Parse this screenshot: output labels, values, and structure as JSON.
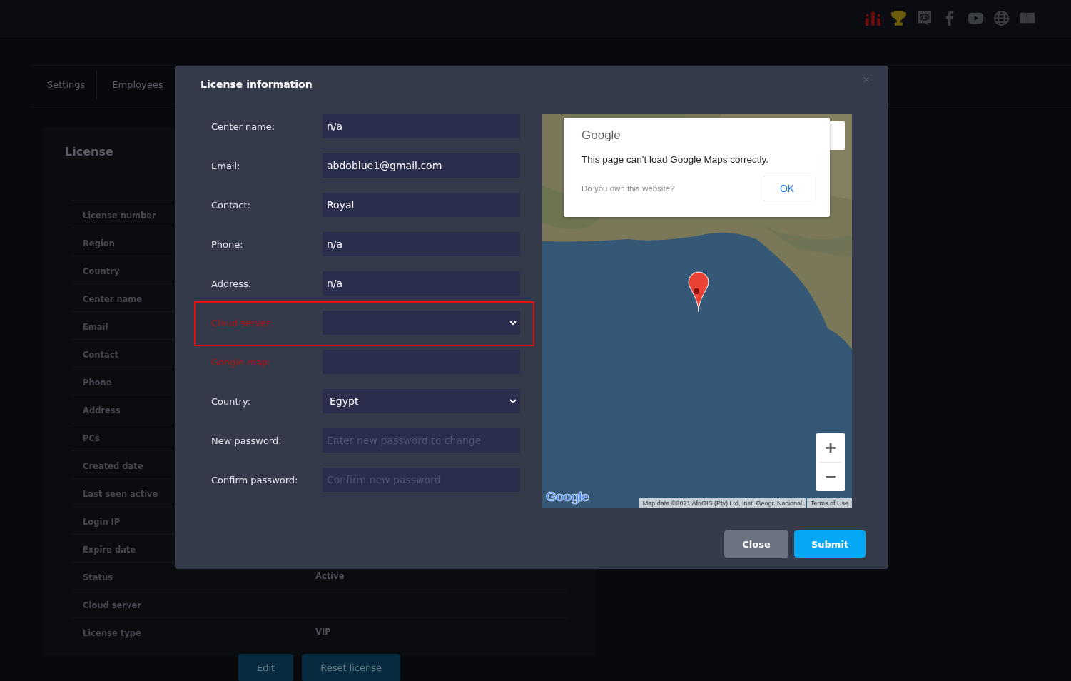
{
  "top_icons": [
    {
      "kind": "chart"
    },
    {
      "kind": "trophy"
    },
    {
      "kind": "chat"
    },
    {
      "kind": "facebook"
    },
    {
      "kind": "play"
    },
    {
      "kind": "globe"
    },
    {
      "kind": "book"
    }
  ],
  "tabs": [
    {
      "label": "Settings"
    },
    {
      "label": "Employees"
    }
  ],
  "license_card": {
    "title": "License",
    "rows": [
      {
        "label": "License number"
      },
      {
        "label": "Region"
      },
      {
        "label": "Country"
      },
      {
        "label": "Center name"
      },
      {
        "label": "Email"
      },
      {
        "label": "Contact"
      },
      {
        "label": "Phone"
      },
      {
        "label": "Address"
      },
      {
        "label": "PCs"
      },
      {
        "label": "Created date"
      },
      {
        "label": "Last seen active"
      },
      {
        "label": "Login IP"
      },
      {
        "label": "Expire date"
      },
      {
        "label": "Status",
        "value": "Active"
      },
      {
        "label": "Cloud server"
      },
      {
        "label": "License type",
        "value": "VIP"
      }
    ],
    "buttons": [
      "Edit",
      "Reset license"
    ]
  },
  "modal": {
    "title": "License information",
    "close": "×",
    "fields": [
      {
        "label": "Center name:",
        "kind": "input",
        "value": "n/a",
        "error": false
      },
      {
        "label": "Email:",
        "kind": "input",
        "value": "abdoblue1@gmail.com",
        "error": false
      },
      {
        "label": "Contact:",
        "kind": "input",
        "value": "Royal",
        "error": false
      },
      {
        "label": "Phone:",
        "kind": "input",
        "value": "n/a",
        "error": false
      },
      {
        "label": "Address:",
        "kind": "input",
        "value": "n/a",
        "error": false
      },
      {
        "label": "Cloud server:",
        "kind": "select",
        "error": true,
        "highlighted": true
      },
      {
        "label": "Google map:",
        "kind": "input",
        "error": true
      },
      {
        "label": "Country:",
        "kind": "select",
        "value": "Egypt",
        "error": false
      },
      {
        "label": "New password:",
        "kind": "input",
        "placeholder": "Enter new password to change",
        "error": false
      },
      {
        "label": "Confirm password:",
        "kind": "input",
        "placeholder": "Confirm new password",
        "error": false
      }
    ],
    "map": {
      "kind": "picture",
      "dialog": {
        "brand": "Google",
        "message": "This page can't load Google Maps correctly.",
        "question": "Do you own this website?",
        "button": "OK"
      },
      "zoom_in": "+",
      "zoom_out": "−",
      "logo": "Google",
      "attribution": "Map data ©2021 AfriGIS (Pty) Ltd, Inst. Geogr. Nacional",
      "terms": "Terms of Use"
    },
    "buttons": [
      {
        "label": "Close",
        "kind": "secondary"
      },
      {
        "label": "Submit",
        "kind": "primary"
      }
    ]
  }
}
